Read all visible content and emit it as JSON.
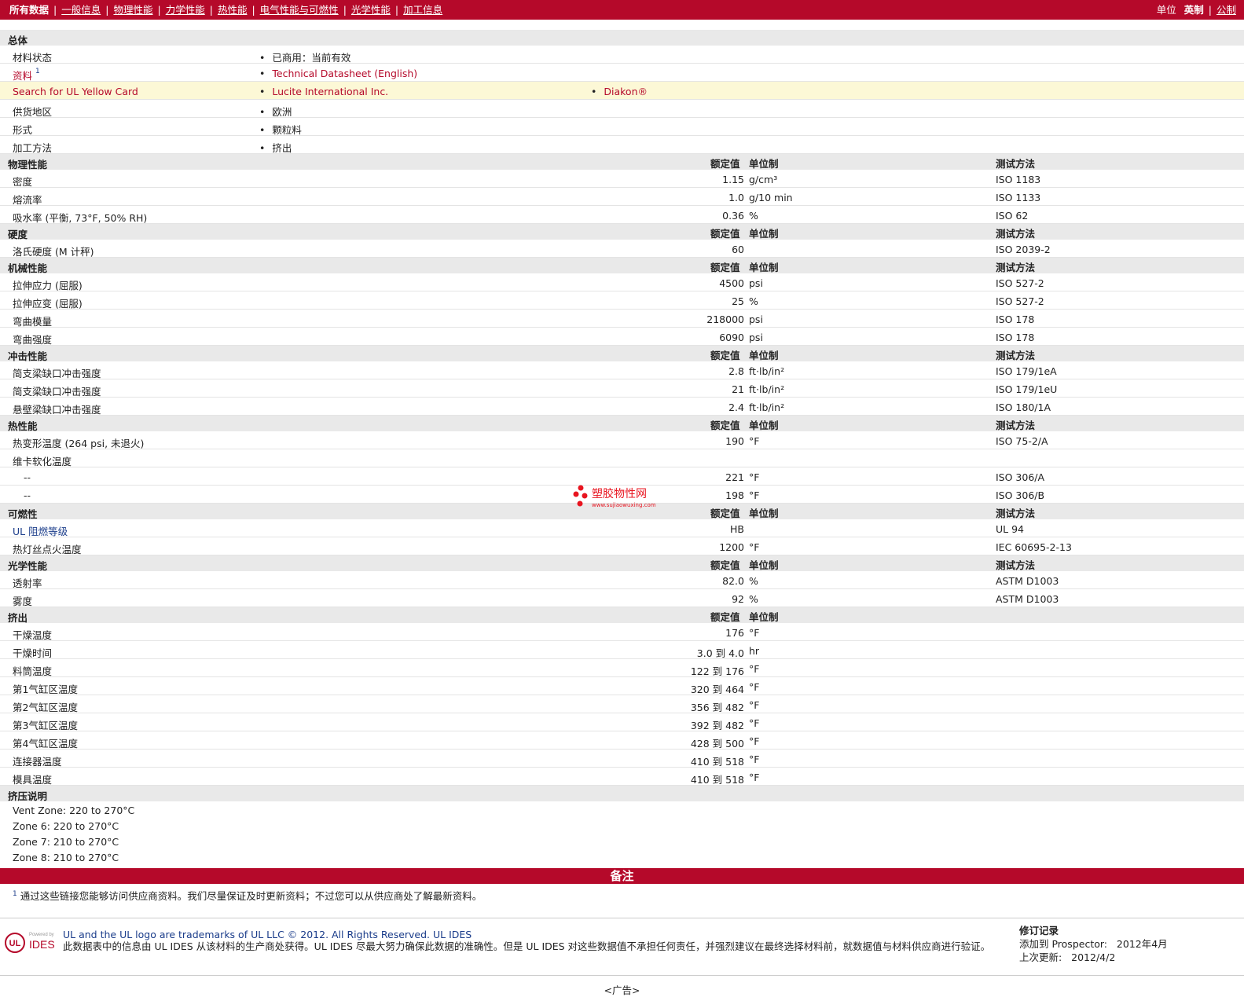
{
  "nav": {
    "current": "所有数据",
    "links": [
      "一般信息",
      "物理性能",
      "力学性能",
      "热性能",
      "电气性能与可燃性",
      "光学性能",
      "加工信息"
    ],
    "units_label": "单位",
    "unit_current": "英制",
    "unit_other": "公制"
  },
  "general": {
    "title": "总体",
    "rows": [
      {
        "label": "材料状态",
        "sup": "",
        "items": [
          "已商用：当前有效"
        ],
        "link": false
      },
      {
        "label": "资料",
        "sup": "1",
        "items": [
          "Technical Datasheet (English)"
        ],
        "link": true
      },
      {
        "label": "Search for UL Yellow Card",
        "sup": "",
        "items": [
          "Lucite International Inc.",
          "Diakon®"
        ],
        "link": true
      },
      {
        "label": "供货地区",
        "sup": "",
        "items": [
          "欧洲"
        ],
        "link": false
      },
      {
        "label": "形式",
        "sup": "",
        "items": [
          "颗粒料"
        ],
        "link": false
      },
      {
        "label": "加工方法",
        "sup": "",
        "items": [
          "挤出"
        ],
        "link": false
      }
    ]
  },
  "headers": {
    "value": "额定值",
    "unit": "单位制",
    "test": "测试方法"
  },
  "sections": [
    {
      "title": "物理性能",
      "test_header": true,
      "rows": [
        {
          "label": "密度",
          "value": "1.15",
          "unit": "g/cm³",
          "test": "ISO 1183"
        },
        {
          "label": "熔流率",
          "value": "1.0",
          "unit": "g/10 min",
          "test": "ISO 1133"
        },
        {
          "label": "吸水率 (平衡, 73°F, 50% RH)",
          "value": "0.36",
          "unit": "%",
          "test": "ISO 62"
        }
      ]
    },
    {
      "title": "硬度",
      "test_header": true,
      "rows": [
        {
          "label": "洛氏硬度 (M 计秤)",
          "value": "60",
          "unit": "",
          "test": "ISO 2039-2"
        }
      ]
    },
    {
      "title": "机械性能",
      "test_header": true,
      "rows": [
        {
          "label": "拉伸应力 (屈服)",
          "value": "4500",
          "unit": "psi",
          "test": "ISO 527-2"
        },
        {
          "label": "拉伸应变 (屈服)",
          "value": "25",
          "unit": "%",
          "test": "ISO 527-2"
        },
        {
          "label": "弯曲模量",
          "value": "218000",
          "unit": "psi",
          "test": "ISO 178"
        },
        {
          "label": "弯曲强度",
          "value": "6090",
          "unit": "psi",
          "test": "ISO 178"
        }
      ]
    },
    {
      "title": "冲击性能",
      "test_header": true,
      "rows": [
        {
          "label": "简支梁缺口冲击强度",
          "value": "2.8",
          "unit": "ft·lb/in²",
          "test": "ISO 179/1eA"
        },
        {
          "label": "简支梁缺口冲击强度",
          "value": "21",
          "unit": "ft·lb/in²",
          "test": "ISO 179/1eU"
        },
        {
          "label": "悬壁梁缺口冲击强度",
          "value": "2.4",
          "unit": "ft·lb/in²",
          "test": "ISO 180/1A"
        }
      ]
    },
    {
      "title": "热性能",
      "test_header": true,
      "rows": [
        {
          "label": "热变形温度 (264 psi, 未退火)",
          "value": "190",
          "unit": "°F",
          "test": "ISO 75-2/A"
        },
        {
          "label": "维卡软化温度",
          "value": "",
          "unit": "",
          "test": ""
        },
        {
          "label": "--",
          "value": "221",
          "unit": "°F",
          "test": "ISO 306/A",
          "indent": true
        },
        {
          "label": "--",
          "value": "198",
          "unit": "°F",
          "test": "ISO 306/B",
          "indent": true
        }
      ]
    },
    {
      "title": "可燃性",
      "test_header": true,
      "rows": [
        {
          "label": "UL 阻燃等级",
          "value": "HB",
          "unit": "",
          "test": "UL 94",
          "link": true
        },
        {
          "label": "热灯丝点火温度",
          "value": "1200",
          "unit": "°F",
          "test": "IEC 60695-2-13"
        }
      ]
    },
    {
      "title": "光学性能",
      "test_header": true,
      "rows": [
        {
          "label": "透射率",
          "value": "82.0",
          "unit": "%",
          "test": "ASTM D1003"
        },
        {
          "label": "雾度",
          "value": "92",
          "unit": "%",
          "test": "ASTM D1003"
        }
      ]
    },
    {
      "title": "挤出",
      "test_header": false,
      "rows": [
        {
          "label": "干燥温度",
          "value": "176",
          "unit": "°F",
          "test": ""
        },
        {
          "label": "干燥时间",
          "value": "3.0 到  4.0",
          "unit": "hr",
          "test": ""
        },
        {
          "label": "料筒温度",
          "value": "122 到  176",
          "unit": "°F",
          "test": ""
        },
        {
          "label": "第1气缸区温度",
          "value": "320 到  464",
          "unit": "°F",
          "test": ""
        },
        {
          "label": "第2气缸区温度",
          "value": "356 到  482",
          "unit": "°F",
          "test": ""
        },
        {
          "label": "第3气缸区温度",
          "value": "392 到  482",
          "unit": "°F",
          "test": ""
        },
        {
          "label": "第4气缸区温度",
          "value": "428 到  500",
          "unit": "°F",
          "test": ""
        },
        {
          "label": "连接器温度",
          "value": "410 到  518",
          "unit": "°F",
          "test": ""
        },
        {
          "label": "模具温度",
          "value": "410 到  518",
          "unit": "°F",
          "test": ""
        }
      ]
    }
  ],
  "notes_section": {
    "title": "挤压说明",
    "lines": [
      "Vent Zone: 220 to 270°C",
      "Zone 6: 220 to 270°C",
      "Zone 7: 210 to 270°C",
      "Zone 8: 210 to 270°C"
    ]
  },
  "remarks": {
    "title": "备注",
    "footnote_num": "1",
    "footnote": "通过这些链接您能够访问供应商资料。我们尽量保证及时更新资料；不过您可以从供应商处了解最新资料。"
  },
  "footer": {
    "logo_text": "IDES",
    "logo_powered": "Powered by",
    "line1": "UL and the UL logo are trademarks of UL LLC © 2012. All Rights Reserved. UL IDES",
    "line2": "此数据表中的信息由  UL IDES 从该材料的生产商处获得。UL IDES 尽最大努力确保此数据的准确性。但是  UL IDES 对这些数据值不承担任何责任，并强烈建议在最终选择材料前，就数据值与材料供应商进行验证。",
    "rev_title": "修订记录",
    "rev_added_label": "添加到  Prospector:",
    "rev_added": "2012年4月",
    "rev_updated_label": "上次更新:",
    "rev_updated": "2012/4/2"
  },
  "ad_label": "<广告>",
  "watermark": {
    "text": "塑胶物性网",
    "url": "www.sujiaowuxing.com"
  },
  "colors": {
    "brand": "#b5092a",
    "section_bg": "#e9e9e9",
    "highlight_bg": "#fcf8d6"
  }
}
